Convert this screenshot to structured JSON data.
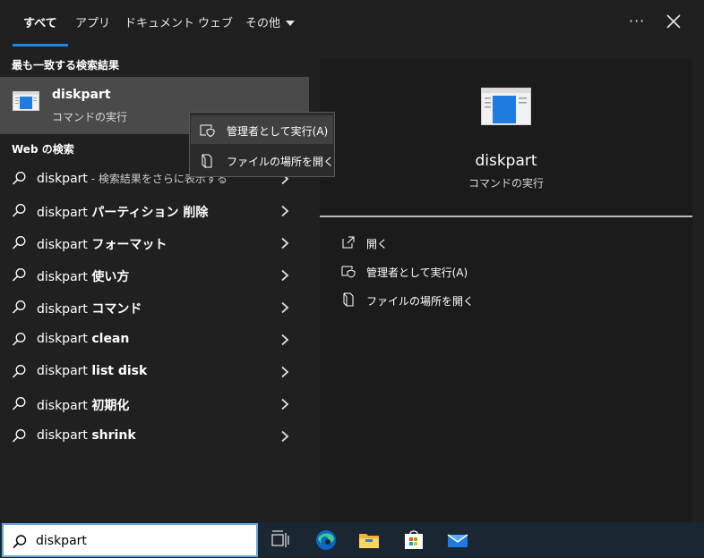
{
  "tabs": [
    {
      "label": "すべて",
      "active": true
    },
    {
      "label": "アプリ"
    },
    {
      "label": "ドキュメント"
    },
    {
      "label": "ウェブ"
    },
    {
      "label": "その他"
    }
  ],
  "header": {
    "more_icon": "more-dots-icon",
    "more_label": "···",
    "close_icon": "close-icon"
  },
  "left": {
    "best_match_title": "最も一致する検索結果",
    "best_match": {
      "name": "diskpart",
      "subtitle": "コマンドの実行",
      "icon": "app-window-icon"
    },
    "web_title": "Web の検索",
    "web_results": [
      {
        "prefix": "diskpart",
        "suffix": "",
        "sub": " - 検索結果をさらに表示する"
      },
      {
        "prefix": "diskpart ",
        "suffix": "パーティション 削除",
        "sub": ""
      },
      {
        "prefix": "diskpart ",
        "suffix": "フォーマット",
        "sub": ""
      },
      {
        "prefix": "diskpart ",
        "suffix": "使い方",
        "sub": ""
      },
      {
        "prefix": "diskpart ",
        "suffix": "コマンド",
        "sub": ""
      },
      {
        "prefix": "diskpart ",
        "suffix": "clean",
        "sub": ""
      },
      {
        "prefix": "diskpart ",
        "suffix": "list disk",
        "sub": ""
      },
      {
        "prefix": "diskpart ",
        "suffix": "初期化",
        "sub": ""
      },
      {
        "prefix": "diskpart ",
        "suffix": "shrink",
        "sub": ""
      }
    ]
  },
  "context_menu": [
    {
      "label": "管理者として実行(A)",
      "icon": "shield-window-icon"
    },
    {
      "label": "ファイルの場所を開く",
      "icon": "file-location-icon"
    }
  ],
  "preview": {
    "name": "diskpart",
    "subtitle": "コマンドの実行",
    "actions": [
      {
        "label": "開く",
        "icon": "open-icon"
      },
      {
        "label": "管理者として実行(A)",
        "icon": "shield-window-icon"
      },
      {
        "label": "ファイルの場所を開く",
        "icon": "file-location-icon"
      }
    ]
  },
  "taskbar": {
    "search_value": "diskpart",
    "icons": [
      "task-view-icon",
      "edge-icon",
      "file-explorer-icon",
      "store-icon",
      "mail-icon"
    ]
  },
  "colors": {
    "accent": "#1e88e5",
    "highlight": "#4a4a4a",
    "taskbar": "#1a2631"
  }
}
